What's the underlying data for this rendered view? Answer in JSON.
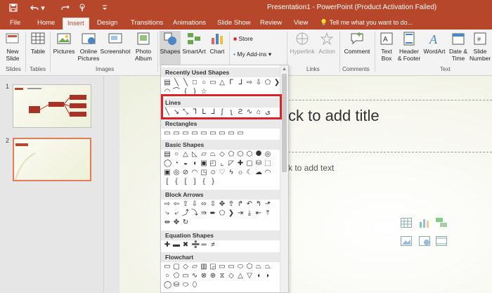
{
  "window": {
    "title": "Presentation1 - PowerPoint (Product Activation Failed)"
  },
  "quick_access": {
    "save_icon": "save-icon",
    "undo_icon": "undo-icon",
    "redo_icon": "redo-icon",
    "touch_icon": "touch-mode-icon",
    "customize_icon": "customize-qat-icon"
  },
  "tabs": [
    {
      "label": "File"
    },
    {
      "label": "Home"
    },
    {
      "label": "Insert"
    },
    {
      "label": "Design"
    },
    {
      "label": "Transitions"
    },
    {
      "label": "Animations"
    },
    {
      "label": "Slide Show"
    },
    {
      "label": "Review"
    },
    {
      "label": "View"
    }
  ],
  "tell_me": "Tell me what you want to do...",
  "ribbon": {
    "new_slide": "New Slide",
    "table": "Table",
    "pictures": "Pictures",
    "online_pictures": "Online Pictures",
    "screenshot": "Screenshot",
    "photo_album": "Photo Album",
    "shapes": "Shapes",
    "smartart": "SmartArt",
    "chart": "Chart",
    "store": "Store",
    "my_addins": "My Add-ins",
    "hyperlink": "Hyperlink",
    "action": "Action",
    "comment": "Comment",
    "text_box": "Text Box",
    "header_footer": "Header & Footer",
    "wordart": "WordArt",
    "date_time": "Date & Time",
    "slide_number": "Slide Number",
    "groups": {
      "slides": "Slides",
      "tables": "Tables",
      "images": "Images",
      "links": "Links",
      "comments": "Comments",
      "text": "Text"
    }
  },
  "shapes_menu": {
    "sections": [
      "Recently Used Shapes",
      "Lines",
      "Rectangles",
      "Basic Shapes",
      "Block Arrows",
      "Equation Shapes",
      "Flowchart"
    ]
  },
  "slides": [
    {
      "number": "1"
    },
    {
      "number": "2"
    }
  ],
  "slide_canvas": {
    "title_placeholder": "ck to add title",
    "text_placeholder": "k to add text"
  },
  "colors": {
    "accent": "#b7472a",
    "highlight": "#d9232a",
    "selection": "#e37b57"
  }
}
